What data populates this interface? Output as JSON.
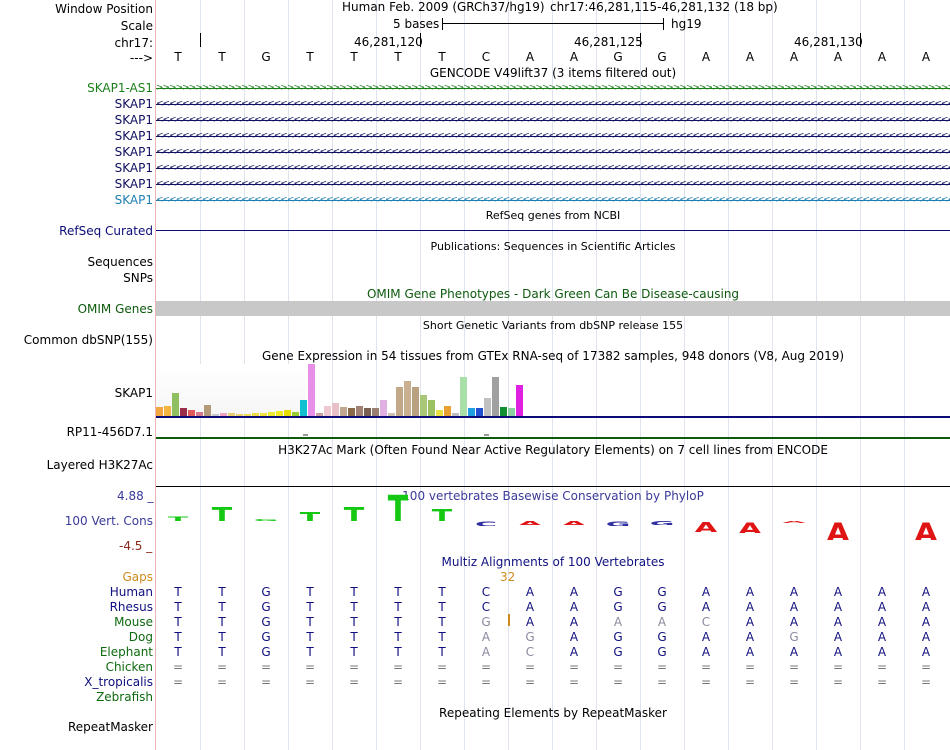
{
  "header": {
    "window_position_label": "Window Position",
    "scale_label": "Scale",
    "chrom_label": "chr17:",
    "strand_label": "--->",
    "assembly_text": "Human Feb. 2009 (GRCh37/hg19)",
    "position_text": "chr17:46,281,115-46,281,132 (18 bp)",
    "scale_bar_text": "5 bases",
    "scale_db_text": "hg19",
    "ruler_ticks": [
      "46,281,120",
      "46,281,125",
      "46,281,130"
    ]
  },
  "reference_bases": [
    "T",
    "T",
    "G",
    "T",
    "T",
    "T",
    "T",
    "C",
    "A",
    "A",
    "G",
    "G",
    "A",
    "A",
    "A",
    "A",
    "A",
    "A"
  ],
  "gencode": {
    "title": "GENCODE V49lift37 (3 items filtered out)",
    "items": [
      {
        "name": "SKAP1-AS1",
        "color": "#1a7f1a",
        "strand": "+"
      },
      {
        "name": "SKAP1",
        "color": "#101060",
        "strand": "-"
      },
      {
        "name": "SKAP1",
        "color": "#101060",
        "strand": "-"
      },
      {
        "name": "SKAP1",
        "color": "#101060",
        "strand": "-"
      },
      {
        "name": "SKAP1",
        "color": "#101060",
        "strand": "-"
      },
      {
        "name": "SKAP1",
        "color": "#101060",
        "strand": "-"
      },
      {
        "name": "SKAP1",
        "color": "#101060",
        "strand": "-"
      },
      {
        "name": "SKAP1",
        "color": "#1e7fb0",
        "strand": "-"
      }
    ]
  },
  "refseq": {
    "title": "RefSeq genes from NCBI",
    "label": "RefSeq Curated",
    "color": "#0c0c78"
  },
  "publications": {
    "title": "Publications: Sequences in Scientific Articles",
    "label": "Sequences"
  },
  "snps_label": "SNPs",
  "omim": {
    "title": "OMIM Gene Phenotypes - Dark Green Can Be Disease-causing",
    "label": "OMIM Genes",
    "title_color": "#0e5a0e"
  },
  "dbsnp": {
    "title": "Short Genetic Variants from dbSNP release 155",
    "label": "Common dbSNP(155)"
  },
  "gtex": {
    "title": "Gene Expression in 54 tissues from GTEx RNA-seq of 17382 samples, 948 donors (V8, Aug 2019)",
    "gene_label": "SKAP1",
    "second_label": "RP11-456D7.1",
    "bars": [
      {
        "value": 0.18,
        "color": "#f2a640"
      },
      {
        "value": 0.2,
        "color": "#f5b640"
      },
      {
        "value": 0.45,
        "color": "#8fbf60"
      },
      {
        "value": 0.15,
        "color": "#9b2c4a"
      },
      {
        "value": 0.12,
        "color": "#e05a5a"
      },
      {
        "value": 0.08,
        "color": "#d47a8a"
      },
      {
        "value": 0.22,
        "color": "#b49a7a"
      },
      {
        "value": 0.04,
        "color": "#c9c9c9"
      },
      {
        "value": 0.05,
        "color": "#f0a0c0"
      },
      {
        "value": 0.06,
        "color": "#e8d070"
      },
      {
        "value": 0.04,
        "color": "#ead26a"
      },
      {
        "value": 0.04,
        "color": "#efdd5a"
      },
      {
        "value": 0.05,
        "color": "#eedd4a"
      },
      {
        "value": 0.06,
        "color": "#f0e040"
      },
      {
        "value": 0.08,
        "color": "#eaea30"
      },
      {
        "value": 0.1,
        "color": "#f0e820"
      },
      {
        "value": 0.12,
        "color": "#e8e000"
      },
      {
        "value": 0.08,
        "color": "#9acd32"
      },
      {
        "value": 0.3,
        "color": "#11c0d0"
      },
      {
        "value": 1.0,
        "color": "#e890e8"
      },
      {
        "value": 0.05,
        "color": "#c8a0a0"
      },
      {
        "value": 0.2,
        "color": "#f0c8d0"
      },
      {
        "value": 0.25,
        "color": "#e8c0c8"
      },
      {
        "value": 0.18,
        "color": "#c0a890"
      },
      {
        "value": 0.15,
        "color": "#8a6a4a"
      },
      {
        "value": 0.2,
        "color": "#a08070"
      },
      {
        "value": 0.16,
        "color": "#7a6050"
      },
      {
        "value": 0.16,
        "color": "#9a8070"
      },
      {
        "value": 0.3,
        "color": "#e0b0e0"
      },
      {
        "value": 0.05,
        "color": "#d0c0b0"
      },
      {
        "value": 0.55,
        "color": "#c0a888"
      },
      {
        "value": 0.68,
        "color": "#c8b090"
      },
      {
        "value": 0.55,
        "color": "#b8a080"
      },
      {
        "value": 0.4,
        "color": "#a8c878"
      },
      {
        "value": 0.3,
        "color": "#9bc060"
      },
      {
        "value": 0.12,
        "color": "#e8e040"
      },
      {
        "value": 0.2,
        "color": "#e8a030"
      },
      {
        "value": 0.05,
        "color": "#c0c0c0"
      },
      {
        "value": 0.75,
        "color": "#a8e0a8"
      },
      {
        "value": 0.15,
        "color": "#20a0e0"
      },
      {
        "value": 0.15,
        "color": "#2050d0"
      },
      {
        "value": 0.35,
        "color": "#c0c0c0"
      },
      {
        "value": 0.75,
        "color": "#a0a0a0"
      },
      {
        "value": 0.18,
        "color": "#109030"
      },
      {
        "value": 0.15,
        "color": "#8ad0a0"
      },
      {
        "value": 0.6,
        "color": "#e020e0"
      }
    ]
  },
  "h3k27ac": {
    "title": "H3K27Ac Mark (Often Found Near Active Regulatory Elements) on 7 cell lines from ENCODE",
    "label": "Layered H3K27Ac"
  },
  "phylop": {
    "title": "100 vertebrates Basewise Conservation by PhyloP",
    "label": "100 Vert. Cons",
    "max_label": "4.88 _",
    "min_label": "-4.5 _",
    "scores": [
      1.2,
      3.5,
      0.4,
      2.5,
      3.5,
      7.0,
      3.0,
      -1.2,
      -1.0,
      -1.0,
      -1.2,
      -1.0,
      -2.5,
      -2.8,
      -0.3,
      -4.5,
      0,
      -4.5
    ]
  },
  "multiz": {
    "title": "Multiz Alignments of 100 Vertebrates",
    "gaps_label": "Gaps",
    "gap_count": "32",
    "species": [
      {
        "name": "Human",
        "color": "#101080",
        "bases": [
          "T",
          "T",
          "G",
          "T",
          "T",
          "T",
          "T",
          "C",
          "A",
          "A",
          "G",
          "G",
          "A",
          "A",
          "A",
          "A",
          "A",
          "A"
        ]
      },
      {
        "name": "Rhesus",
        "color": "#101080",
        "bases": [
          "T",
          "T",
          "G",
          "T",
          "T",
          "T",
          "T",
          "C",
          "A",
          "A",
          "G",
          "G",
          "A",
          "A",
          "A",
          "A",
          "A",
          "A"
        ]
      },
      {
        "name": "Mouse",
        "color": "#0e6a0e",
        "bases": [
          "T",
          "T",
          "G",
          "T",
          "T",
          "T",
          "T",
          "G",
          "A",
          "A",
          "A",
          "A",
          "C",
          "A",
          "A",
          "A",
          "A",
          "A"
        ]
      },
      {
        "name": "Dog",
        "color": "#0e6a0e",
        "bases": [
          "T",
          "T",
          "G",
          "T",
          "T",
          "T",
          "T",
          "A",
          "G",
          "A",
          "G",
          "G",
          "A",
          "A",
          "G",
          "A",
          "A",
          "A"
        ]
      },
      {
        "name": "Elephant",
        "color": "#0e6a0e",
        "bases": [
          "T",
          "T",
          "G",
          "T",
          "T",
          "T",
          "T",
          "A",
          "C",
          "A",
          "G",
          "G",
          "A",
          "A",
          "A",
          "A",
          "A",
          "A"
        ]
      },
      {
        "name": "Chicken",
        "color": "#0e6a0e",
        "bases": [
          "=",
          "=",
          "=",
          "=",
          "=",
          "=",
          "=",
          "=",
          "=",
          "=",
          "=",
          "=",
          "=",
          "=",
          "=",
          "=",
          "=",
          "="
        ]
      },
      {
        "name": "X_tropicalis",
        "color": "#101080",
        "bases": [
          "=",
          "=",
          "=",
          "=",
          "=",
          "=",
          "=",
          "=",
          "=",
          "=",
          "=",
          "=",
          "=",
          "=",
          "=",
          "=",
          "=",
          "="
        ]
      },
      {
        "name": "Zebrafish",
        "color": "#0e6a0e",
        "bases": []
      }
    ],
    "mismatch_cells": [
      [
        2,
        7
      ],
      [
        2,
        10
      ],
      [
        2,
        11
      ],
      [
        2,
        12
      ],
      [
        3,
        7
      ],
      [
        3,
        8
      ],
      [
        3,
        14
      ],
      [
        4,
        7
      ],
      [
        4,
        8
      ]
    ]
  },
  "repeatmasker": {
    "title": "Repeating Elements by RepeatMasker",
    "label": "RepeatMasker"
  },
  "colors": {
    "label_border": "#e8b5b5",
    "gridline": "#dde4ee",
    "phylop_pos": "#14c814",
    "phylop_neg": "#e01414",
    "gap_orange": "#d08a1c",
    "omim_bar": "#c8c8c8"
  }
}
